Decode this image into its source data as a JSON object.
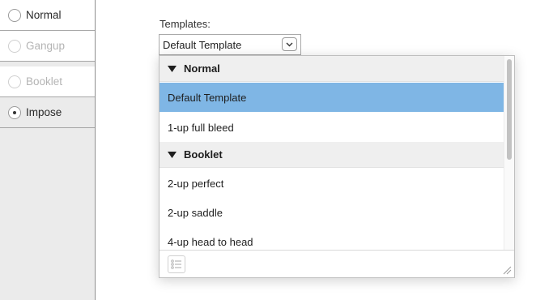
{
  "modes": [
    {
      "label": "Normal",
      "checked": false,
      "disabled": false
    },
    {
      "label": "Gangup",
      "checked": false,
      "disabled": true
    },
    {
      "label": "Booklet",
      "checked": false,
      "disabled": true
    },
    {
      "label": "Impose",
      "checked": true,
      "disabled": false
    }
  ],
  "templates": {
    "label": "Templates:",
    "selected": "Default Template",
    "groups": [
      {
        "name": "Normal",
        "items": [
          "Default Template",
          "1-up full bleed"
        ]
      },
      {
        "name": "Booklet",
        "items": [
          "2-up perfect",
          "2-up saddle",
          "4-up head to head"
        ]
      }
    ]
  }
}
